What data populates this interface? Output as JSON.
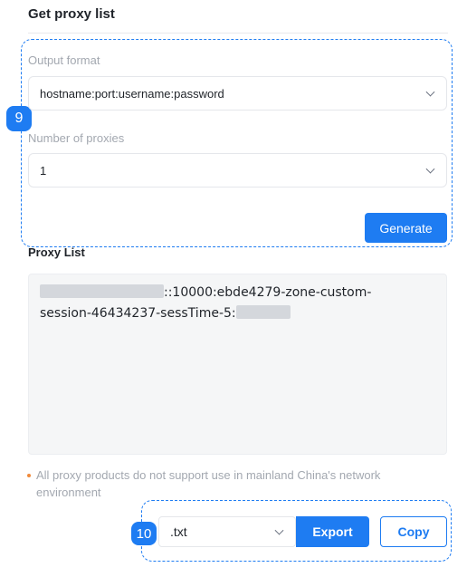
{
  "header": {
    "title": "Get proxy list"
  },
  "steps": {
    "step_a": "9",
    "step_b": "10"
  },
  "form": {
    "output_format": {
      "label": "Output format",
      "value": "hostname:port:username:password"
    },
    "number_of_proxies": {
      "label": "Number of proxies",
      "value": "1"
    },
    "generate_label": "Generate"
  },
  "proxy_list": {
    "label": "Proxy List",
    "line1_visible": "::10000:ebde4279-zone-custom-",
    "line2_visible": "session-46434237-sessTime-5:"
  },
  "notice": {
    "text": "All proxy products do not support use in mainland China's network environment"
  },
  "export": {
    "format_value": ".txt",
    "export_label": "Export",
    "copy_label": "Copy"
  },
  "colors": {
    "accent": "#1e7cf2",
    "notice_dot": "#f08a3b"
  }
}
